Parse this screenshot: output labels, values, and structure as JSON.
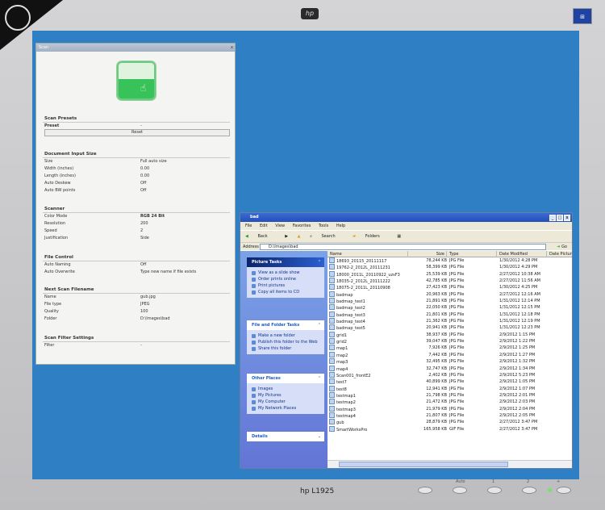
{
  "monitor": {
    "top_logo": "hp",
    "model": "hp L1925",
    "controls": [
      "Auto",
      "1",
      "2",
      "+"
    ]
  },
  "scan_window": {
    "title": "Scan",
    "close": "x",
    "sections": {
      "presets": {
        "title": "Scan Presets",
        "preset_label": "Preset",
        "preset_value": "-",
        "reset_label": "Reset"
      },
      "doc": {
        "title": "Document Input Size",
        "rows": [
          {
            "k": "Size",
            "v": "Full auto size"
          },
          {
            "k": "Width (inches)",
            "v": "0.00"
          },
          {
            "k": "Length (inches)",
            "v": "0.00"
          },
          {
            "k": "Auto Deskew",
            "v": "Off"
          },
          {
            "k": "Auto BW points",
            "v": "Off"
          }
        ]
      },
      "scanner": {
        "title": "Scanner",
        "rows": [
          {
            "k": "Color Mode",
            "v": "RGB 24 Bit"
          },
          {
            "k": "Resolution",
            "v": "200"
          },
          {
            "k": "Speed",
            "v": "2"
          },
          {
            "k": "Justification",
            "v": "Side"
          }
        ]
      },
      "file": {
        "title": "File Control",
        "rows": [
          {
            "k": "Auto Naming",
            "v": "Off"
          },
          {
            "k": "Auto Overwrite",
            "v": "Type new name if file exists"
          }
        ]
      },
      "next": {
        "title": "Next Scan Filename",
        "rows": [
          {
            "k": "Name",
            "v": "gub.jpg"
          },
          {
            "k": "File type",
            "v": "JPEG"
          },
          {
            "k": "Quality",
            "v": "100"
          },
          {
            "k": "Folder",
            "v": "D:\\Images\\bad"
          }
        ]
      },
      "filter": {
        "title": "Scan Filter Settings",
        "rows": [
          {
            "k": "Filter",
            "v": "-"
          }
        ]
      }
    }
  },
  "explorer": {
    "title": "bad",
    "menu": [
      "File",
      "Edit",
      "View",
      "Favorites",
      "Tools",
      "Help"
    ],
    "toolbar": {
      "back": "Back",
      "search": "Search",
      "folders": "Folders"
    },
    "address_label": "Address",
    "address_value": "D:\\Images\\bad",
    "go": "Go",
    "columns": [
      "Name",
      "Size",
      "Type",
      "Date Modified",
      "Date Picture"
    ],
    "picture_tasks": {
      "title": "Picture Tasks",
      "items": [
        "View as a slide show",
        "Order prints online",
        "Print pictures",
        "Copy all items to CD"
      ]
    },
    "file_tasks": {
      "title": "File and Folder Tasks",
      "items": [
        "Make a new folder",
        "Publish this folder to the Web",
        "Share this folder"
      ]
    },
    "other_places": {
      "title": "Other Places",
      "items": [
        "Images",
        "My Pictures",
        "My Computer",
        "My Network Places"
      ]
    },
    "details": {
      "title": "Details"
    },
    "files": [
      {
        "name": "18693_20115_20111117",
        "size": "78,244 KB",
        "type": "JPG File",
        "date": "1/30/2012 4:28 PM"
      },
      {
        "name": "19762-2_2012L_20111231",
        "size": "58,399 KB",
        "type": "JPG File",
        "date": "1/30/2012 4:29 PM"
      },
      {
        "name": "18000_2011L_20110922_uzsF3",
        "size": "25,539 KB",
        "type": "JPG File",
        "date": "2/27/2012 10:38 AM"
      },
      {
        "name": "18035-2_2012L_20111222",
        "size": "42,785 KB",
        "type": "JPG File",
        "date": "2/27/2012 11:56 AM"
      },
      {
        "name": "18075-2_2011L_20110908",
        "size": "27,423 KB",
        "type": "JPG File",
        "date": "1/30/2012 4:25 PM"
      },
      {
        "name": "badmap",
        "size": "20,963 KB",
        "type": "JPG File",
        "date": "2/27/2012 12:16 AM"
      },
      {
        "name": "badmap_test1",
        "size": "21,891 KB",
        "type": "JPG File",
        "date": "1/31/2012 12:14 PM"
      },
      {
        "name": "badmap_test2",
        "size": "22,050 KB",
        "type": "JPG File",
        "date": "1/31/2012 12:15 PM"
      },
      {
        "name": "badmap_test3",
        "size": "21,801 KB",
        "type": "JPG File",
        "date": "1/31/2012 12:18 PM"
      },
      {
        "name": "badmap_test4",
        "size": "21,362 KB",
        "type": "JPG File",
        "date": "1/31/2012 12:19 PM"
      },
      {
        "name": "badmap_test5",
        "size": "20,941 KB",
        "type": "JPG File",
        "date": "1/31/2012 12:23 PM"
      },
      {
        "name": "grid1",
        "size": "38,937 KB",
        "type": "JPG File",
        "date": "2/9/2012 1:15 PM"
      },
      {
        "name": "grid2",
        "size": "39,047 KB",
        "type": "JPG File",
        "date": "2/9/2012 1:22 PM"
      },
      {
        "name": "map1",
        "size": "7,926 KB",
        "type": "JPG File",
        "date": "2/9/2012 1:25 PM"
      },
      {
        "name": "map2",
        "size": "7,442 KB",
        "type": "JPG File",
        "date": "2/9/2012 1:27 PM"
      },
      {
        "name": "map3",
        "size": "32,495 KB",
        "type": "JPG File",
        "date": "2/9/2012 1:32 PM"
      },
      {
        "name": "map4",
        "size": "32,747 KB",
        "type": "JPG File",
        "date": "2/9/2012 1:34 PM"
      },
      {
        "name": "Scan001_frontE2",
        "size": "2,402 KB",
        "type": "JPG File",
        "date": "2/9/2012 5:23 PM"
      },
      {
        "name": "test7",
        "size": "40,899 KB",
        "type": "JPG File",
        "date": "2/9/2012 1:05 PM"
      },
      {
        "name": "test8",
        "size": "12,941 KB",
        "type": "JPG File",
        "date": "2/9/2012 1:07 PM"
      },
      {
        "name": "testmap1",
        "size": "21,798 KB",
        "type": "JPG File",
        "date": "2/9/2012 2:01 PM"
      },
      {
        "name": "testmap2",
        "size": "21,472 KB",
        "type": "JPG File",
        "date": "2/9/2012 2:03 PM"
      },
      {
        "name": "testmap3",
        "size": "21,979 KB",
        "type": "JPG File",
        "date": "2/9/2012 2:04 PM"
      },
      {
        "name": "testmap4",
        "size": "21,807 KB",
        "type": "JPG File",
        "date": "2/9/2012 2:05 PM"
      },
      {
        "name": "gub",
        "size": "28,879 KB",
        "type": "JPG File",
        "date": "2/27/2012 3:47 PM"
      },
      {
        "name": "SmartWorksPro",
        "size": "165,958 KB",
        "type": "GIF File",
        "date": "2/27/2012 3:47 PM"
      }
    ]
  }
}
